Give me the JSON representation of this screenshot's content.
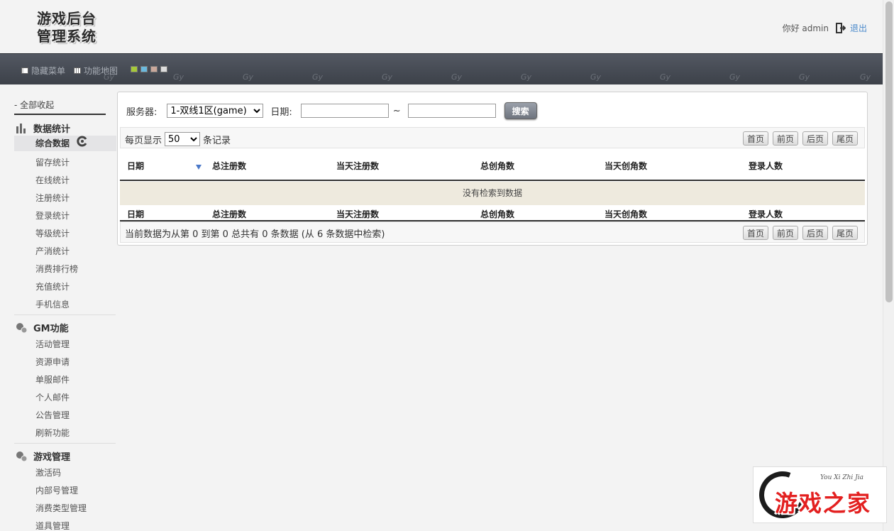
{
  "header": {
    "logo_line1": "游戏后台",
    "logo_line2": "管理系统",
    "greeting": "你好 admin",
    "logout": "退出"
  },
  "navbar": {
    "hide_menu": "隐藏菜单",
    "site_map": "功能地图",
    "theme_colors": [
      "#a6c93a",
      "#6bb9dd",
      "#c9a89b",
      "#dddddd"
    ],
    "watermark": "Gy"
  },
  "sidebar": {
    "collapse_all": "- 全部收起",
    "groups": [
      {
        "title": "数据统计",
        "items": [
          "综合数据",
          "留存统计",
          "在线统计",
          "注册统计",
          "登录统计",
          "等级统计",
          "产消统计",
          "消费排行榜",
          "充值统计",
          "手机信息"
        ]
      },
      {
        "title": "GM功能",
        "items": [
          "活动管理",
          "资源申请",
          "单服邮件",
          "个人邮件",
          "公告管理",
          "刷新功能"
        ]
      },
      {
        "title": "游戏管理",
        "items": [
          "激活码",
          "内部号管理",
          "消费类型管理",
          "道具管理"
        ]
      }
    ]
  },
  "filter": {
    "server_label": "服务器:",
    "server_value": "1-双线1区(game)",
    "date_label": "日期:",
    "date_from": "",
    "date_to": "",
    "separator": "~",
    "search_button": "搜索"
  },
  "table": {
    "page_size_prefix": "每页显示",
    "page_size": "50",
    "page_size_suffix": "条记录",
    "pager": {
      "first": "首页",
      "prev": "前页",
      "next": "后页",
      "last": "尾页"
    },
    "columns": [
      "日期",
      "总注册数",
      "当天注册数",
      "总创角数",
      "当天创角数",
      "登录人数"
    ],
    "empty_message": "没有检索到数据",
    "info": "当前数据为从第 0 到第 0 总共有 0 条数据 (从 6 条数据中检索)"
  },
  "corner_logo": {
    "subtitle": "You Xi Zhi Jia",
    "title": "游戏之家"
  }
}
